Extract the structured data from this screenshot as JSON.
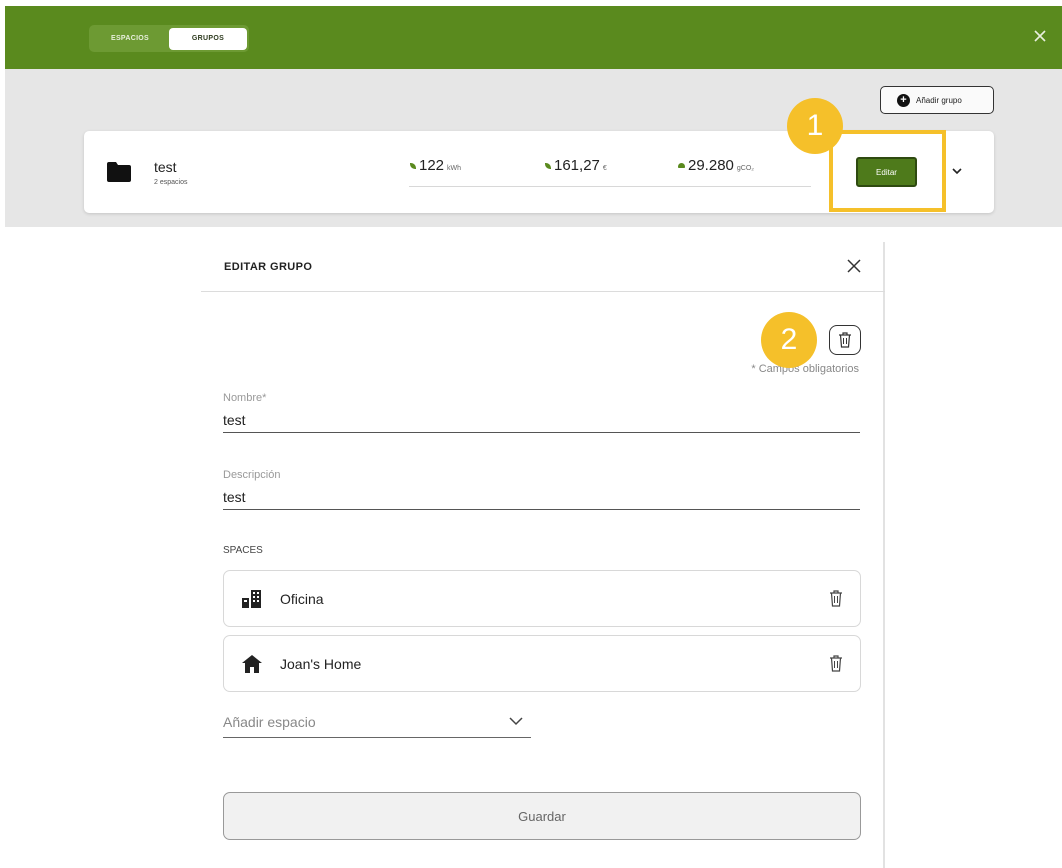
{
  "topbar": {
    "tabs": [
      {
        "label": "ESPACIOS",
        "active": false
      },
      {
        "label": "GRUPOS",
        "active": true
      }
    ],
    "close_icon": "close-icon",
    "color": "#5a8a1e"
  },
  "toolbar": {
    "add_group_label": "Añadir grupo",
    "add_group_icon": "plus-circle-icon"
  },
  "group": {
    "name": "test",
    "subtitle": "2 espacios",
    "energy_value": "122",
    "energy_unit": "kWh",
    "cost_value": "161,27",
    "cost_unit": "€",
    "co2_value": "29.280",
    "co2_unit": "gCO₂",
    "edit_label": "Editar"
  },
  "badges": {
    "one": "1",
    "two": "2",
    "color": "#f5c02a"
  },
  "panel": {
    "title": "EDITAR GRUPO",
    "required_note": "* Campos obligatorios",
    "name_label": "Nombre*",
    "name_value": "test",
    "description_label": "Descripción",
    "description_value": "test",
    "spaces_label": "SPACES",
    "spaces": [
      {
        "name": "Oficina",
        "icon": "building-icon"
      },
      {
        "name": "Joan's Home",
        "icon": "house-icon"
      }
    ],
    "add_space_placeholder": "Añadir espacio",
    "save_label": "Guardar"
  }
}
